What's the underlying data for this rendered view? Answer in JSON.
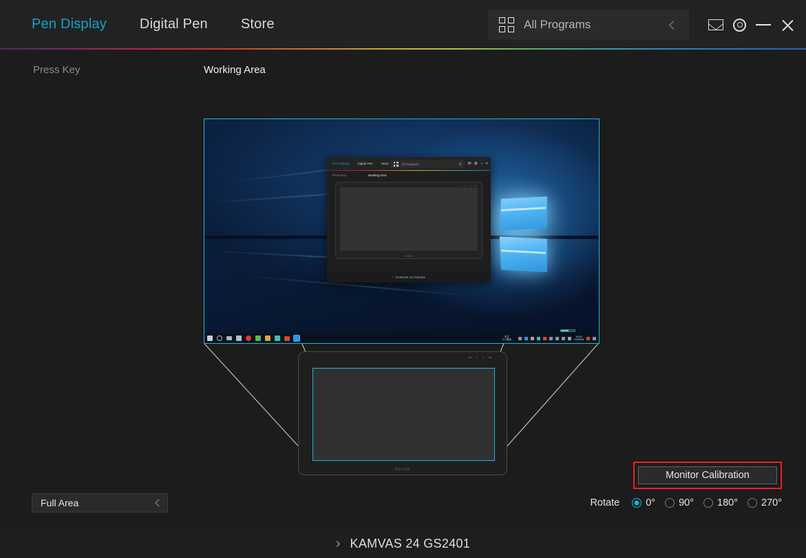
{
  "header": {
    "tabs": [
      {
        "label": "Pen Display",
        "active": true
      },
      {
        "label": "Digital Pen",
        "active": false
      },
      {
        "label": "Store",
        "active": false
      }
    ],
    "programs_selector": {
      "label": "All Programs",
      "grid_icon": "grid-icon",
      "chevron_icon": "chevron-left-icon"
    },
    "window_controls": {
      "mail_icon": "mail-icon",
      "settings_icon": "gear-icon",
      "minimize_icon": "minimize-icon",
      "close_icon": "close-icon"
    },
    "accent_color": "#13a4c4",
    "divider_gradient": "purple-red-orange-yellow-green-cyan-blue"
  },
  "subtabs": [
    {
      "label": "Press Key",
      "active": false
    },
    {
      "label": "Working Area",
      "active": true
    }
  ],
  "preview": {
    "monitor": {
      "border_color": "#1fb6d8",
      "wallpaper": "windows-10-hero-blue",
      "logo_icon": "windows-logo-icon",
      "nested_window": {
        "tabs": [
          {
            "label": "Pen Display",
            "active": true
          },
          {
            "label": "Digital Pen",
            "active": false
          },
          {
            "label": "Store",
            "active": false
          }
        ],
        "programs_label": "All Programs",
        "subtabs": [
          {
            "label": "Press Key",
            "active": false
          },
          {
            "label": "Working Area",
            "active": true
          }
        ],
        "brand": "HUION",
        "device_name": "KAMVAS 24 GS2401",
        "chevron": "›"
      },
      "taskbar": {
        "clock_time": "16:35",
        "clock_date": "2025/5/8",
        "ime_top": "中文",
        "ime_bottom": "CH 简体"
      }
    },
    "tablet": {
      "brand": "HUION",
      "working_area_border_color": "#1fb6d8"
    },
    "guide_line_color": "#cfc8bd"
  },
  "controls": {
    "area_select": {
      "value": "Full Area",
      "chevron_icon": "chevron-left-icon"
    },
    "calibration_button": {
      "label": "Monitor Calibration",
      "highlight_color": "#f02020"
    },
    "rotate": {
      "label": "Rotate",
      "selected": "0°",
      "options": [
        "0°",
        "90°",
        "180°",
        "270°"
      ]
    }
  },
  "footer": {
    "chevron": "›",
    "device_name": "KAMVAS 24 GS2401"
  }
}
